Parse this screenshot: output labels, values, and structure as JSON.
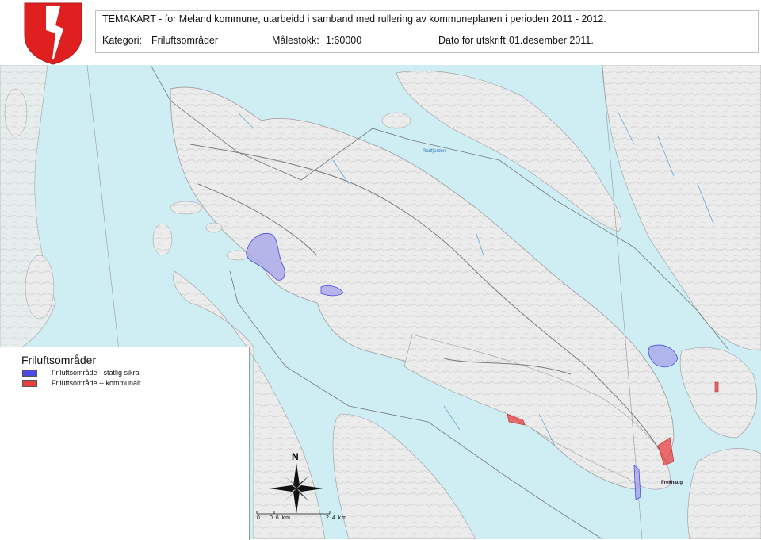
{
  "header": {
    "title": "TEMAKART - for Meland kommune, utarbeidd i samband med rullering av kommuneplanen i perioden 2011 - 2012.",
    "category_label": "Kategori:",
    "category_value": "Friluftsområder",
    "scale_label": "Målestokk:",
    "scale_value": "1:60000",
    "date_label": "Dato for utskrift:",
    "date_value": "01.desember 2011."
  },
  "legend": {
    "title": "Friluftsområder",
    "items": [
      {
        "label": "Friluftsområde - statlig sikra",
        "color": "#4a4ae0"
      },
      {
        "label": "Friluftsområde -- kommunalt",
        "color": "#e84040"
      }
    ]
  },
  "compass": {
    "north_label": "N"
  },
  "scalebar": {
    "ticks": [
      "0",
      "0.6 km",
      "2.4 km"
    ]
  },
  "map": {
    "water_color": "#cfeef4",
    "land_color": "#ebebeb",
    "place_names": [
      "Radfjorden",
      "Frekhaug"
    ]
  }
}
